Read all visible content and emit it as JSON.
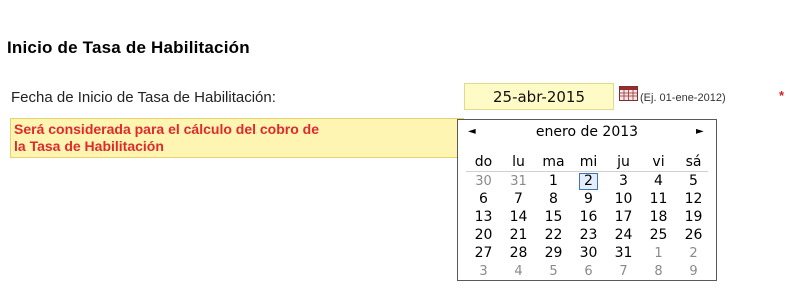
{
  "section": {
    "title": "Inicio de Tasa de Habilitación"
  },
  "field": {
    "label": "Fecha de Inicio de Tasa de Habilitación:",
    "value": "25-abr-2015",
    "hint": "(Ej. 01-ene-2012)",
    "required_mark": "*"
  },
  "notice": {
    "line1": "Será considerada para el cálculo del cobro de",
    "line2": "la Tasa de Habilitación"
  },
  "calendar": {
    "prev": "◄",
    "next": "►",
    "month_label": "enero de 2013",
    "weekdays": [
      "do",
      "lu",
      "ma",
      "mi",
      "ju",
      "vi",
      "sá"
    ],
    "weeks": [
      [
        "30",
        "31",
        "1",
        "2",
        "3",
        "4",
        "5"
      ],
      [
        "6",
        "7",
        "8",
        "9",
        "10",
        "11",
        "12"
      ],
      [
        "13",
        "14",
        "15",
        "16",
        "17",
        "18",
        "19"
      ],
      [
        "20",
        "21",
        "22",
        "23",
        "24",
        "25",
        "26"
      ],
      [
        "27",
        "28",
        "29",
        "30",
        "31",
        "1",
        "2"
      ],
      [
        "3",
        "4",
        "5",
        "6",
        "7",
        "8",
        "9"
      ]
    ],
    "selected_day": "2"
  },
  "icons": {
    "calendar_button": "calendar-icon"
  }
}
